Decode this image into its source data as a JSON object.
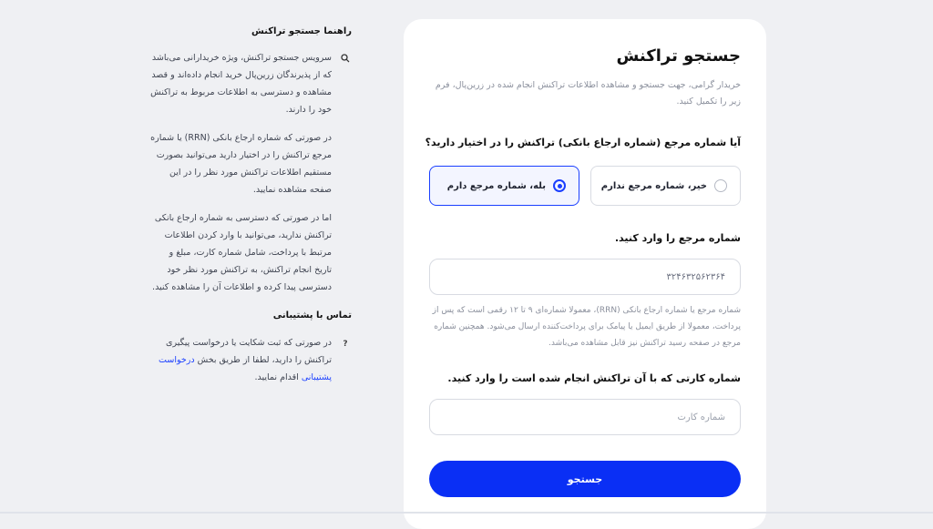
{
  "search_card": {
    "title": "جستجو تراکنش",
    "subtitle": "خریدار گرامی، جهت جستجو و مشاهده اطلاعات تراکنش انجام شده در زرین‌پال، فرم زیر را تکمیل کنید.",
    "question": "آیا شماره مرجع (شماره ارجاع بانکی) تراکنش را در اختیار دارید؟",
    "option_yes": "بله، شماره مرجع دارم",
    "option_no": "خیر، شماره مرجع ندارم",
    "selected_option": "yes",
    "ref_label": "شماره مرجع را وارد کنید.",
    "ref_value": "۳۲۴۶۳۲۵۶۲۳۶۴",
    "ref_hint": "شماره مرجع یا شماره ارجاع بانکی (RRN)، معمولا شماره‌ای ۹ تا ۱۲ رقمی است که پس از پرداخت، معمولا از طریق ایمیل یا پیامک برای پرداخت‌کننده ارسال می‌شود. همچنین شماره مرجع در صفحه رسید تراکنش نیز قابل مشاهده می‌باشد.",
    "card_label": "شماره کارتی که با آن تراکنش انجام شده است را وارد کنید.",
    "card_placeholder": "شماره کارت",
    "submit_label": "جستجو"
  },
  "sidebar": {
    "guide_title": "راهنما جستجو تراکنش",
    "guide_icon": "search-icon",
    "guide_paragraphs": [
      "سرویس جستجو تراکنش، ویژه خریدارانی می‌باشد که از پذیرندگان زرین‌پال خرید انجام داده‌اند و قصد مشاهده و دسترسی به اطلاعات مربوط به تراکنش خود را دارند.",
      "در صورتی که شماره ارجاع بانکی (RRN) یا شماره مرجع تراکنش را در اختیار دارید می‌توانید بصورت مستقیم اطلاعات تراکنش مورد نظر را در این صفحه مشاهده نمایید.",
      "اما در صورتی که دسترسی به شماره ارجاع بانکی تراکنش ندارید، می‌توانید با وارد کردن اطلاعات مرتبط با پرداخت، شامل شماره کارت، مبلغ و تاریخ انجام تراکنش، به تراکنش مورد نظر خود دسترسی پیدا کرده و اطلاعات آن را مشاهده کنید."
    ],
    "support_title": "تماس با پشتیبانی",
    "support_icon": "question-icon",
    "support_text_before": "در صورتی که ثبت شکایت یا درخواست پیگیری تراکنش را دارید، لطفا از طریق بخش",
    "support_link": "درخواست پشتیبانی",
    "support_text_after": "اقدام نمایید.",
    "link_color": "#1a3fff"
  },
  "colors": {
    "accent": "#0a2ff5",
    "background": "#eff0f3"
  }
}
